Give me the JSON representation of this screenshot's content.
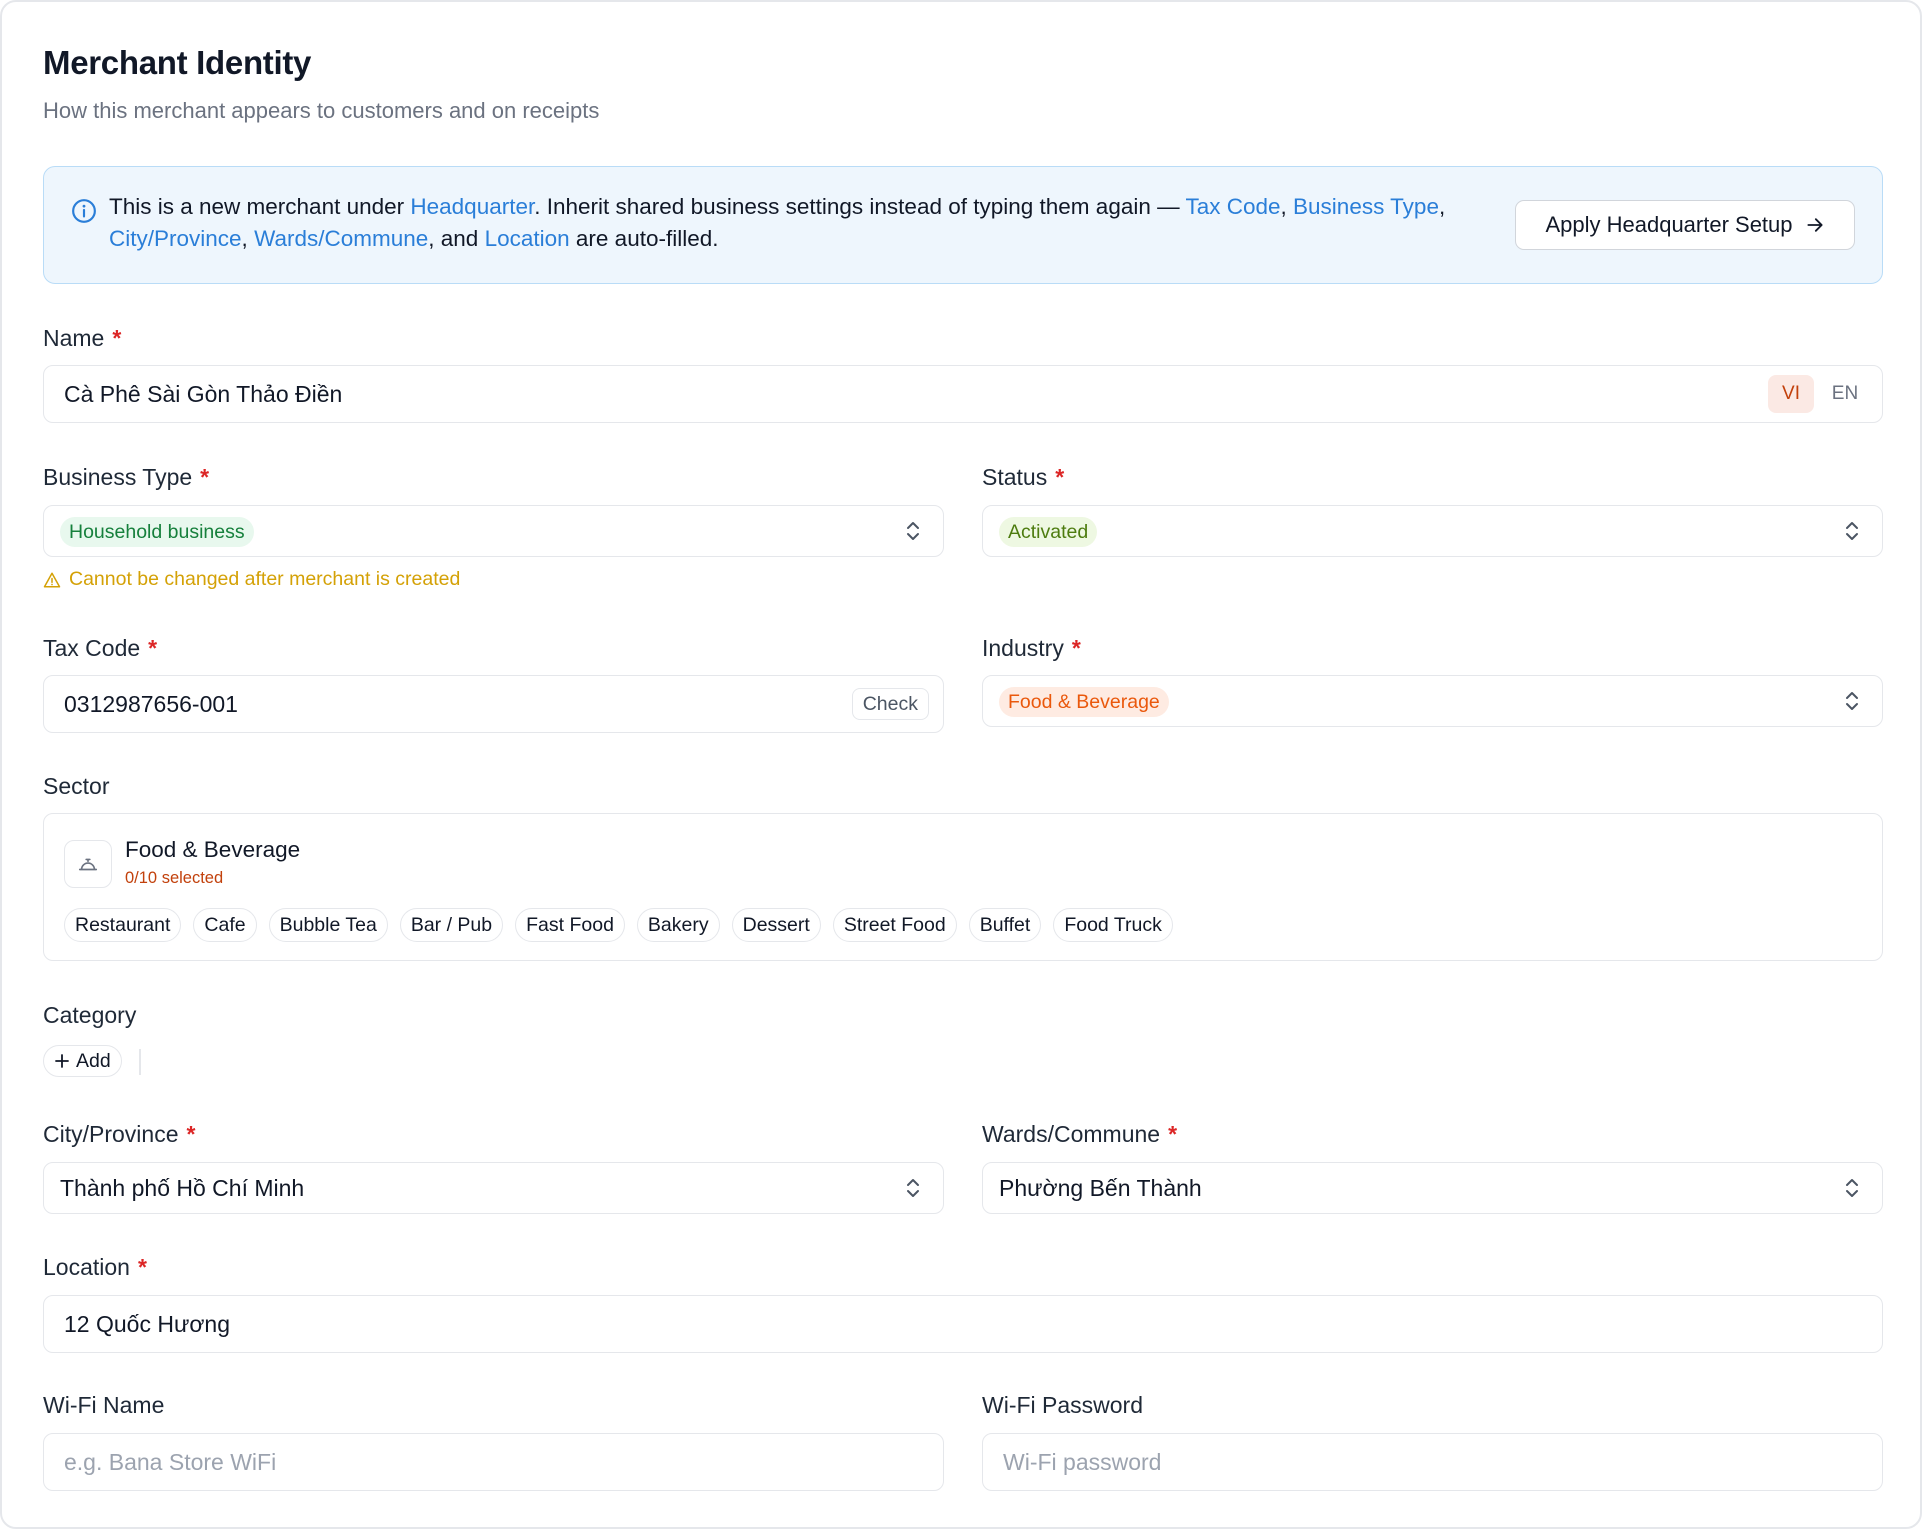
{
  "header": {
    "title": "Merchant Identity",
    "subtitle": "How this merchant appears to customers and on receipts"
  },
  "info_banner": {
    "text_1": "This is a new merchant under ",
    "link_headquarter": "Headquarter",
    "text_2": ". Inherit shared business settings instead of typing them again — ",
    "link_tax_code": "Tax Code",
    "sep_1": ", ",
    "link_business_type": "Business Type",
    "sep_2": ", ",
    "link_city": "City/Province",
    "sep_3": ", ",
    "link_wards": "Wards/Commune",
    "text_3": ", and ",
    "link_location": "Location",
    "text_4": " are auto-filled.",
    "apply_button": "Apply Headquarter Setup"
  },
  "name": {
    "label": "Name",
    "required": "*",
    "value": "Cà Phê Sài Gòn Thảo Điền",
    "lang_vi": "VI",
    "lang_en": "EN",
    "active_lang": "VI"
  },
  "business_type": {
    "label": "Business Type",
    "required": "*",
    "value": "Household business",
    "warning": "Cannot be changed after merchant is created"
  },
  "status": {
    "label": "Status",
    "required": "*",
    "value": "Activated"
  },
  "tax_code": {
    "label": "Tax Code",
    "required": "*",
    "value": "0312987656-001",
    "check_button": "Check"
  },
  "industry": {
    "label": "Industry",
    "required": "*",
    "value": "Food & Beverage"
  },
  "sector": {
    "label": "Sector",
    "group_name": "Food & Beverage",
    "selected_count": "0/10 selected",
    "options": [
      "Restaurant",
      "Cafe",
      "Bubble Tea",
      "Bar / Pub",
      "Fast Food",
      "Bakery",
      "Dessert",
      "Street Food",
      "Buffet",
      "Food Truck"
    ]
  },
  "category": {
    "label": "Category",
    "add_button": "Add"
  },
  "city": {
    "label": "City/Province",
    "required": "*",
    "value": "Thành phố Hồ Chí Minh"
  },
  "wards": {
    "label": "Wards/Commune",
    "required": "*",
    "value": "Phường Bến Thành"
  },
  "location": {
    "label": "Location",
    "required": "*",
    "value": "12 Quốc Hương"
  },
  "wifi_name": {
    "label": "Wi-Fi Name",
    "placeholder": "e.g. Bana Store WiFi"
  },
  "wifi_password": {
    "label": "Wi-Fi Password",
    "placeholder": "Wi-Fi password"
  },
  "colors": {
    "accent_link": "#2a7ed8",
    "required": "#dc2626",
    "warning": "#d4a106",
    "banner_bg": "#eef6fd",
    "status_green": "#16803c",
    "industry_orange": "#ea580c"
  }
}
